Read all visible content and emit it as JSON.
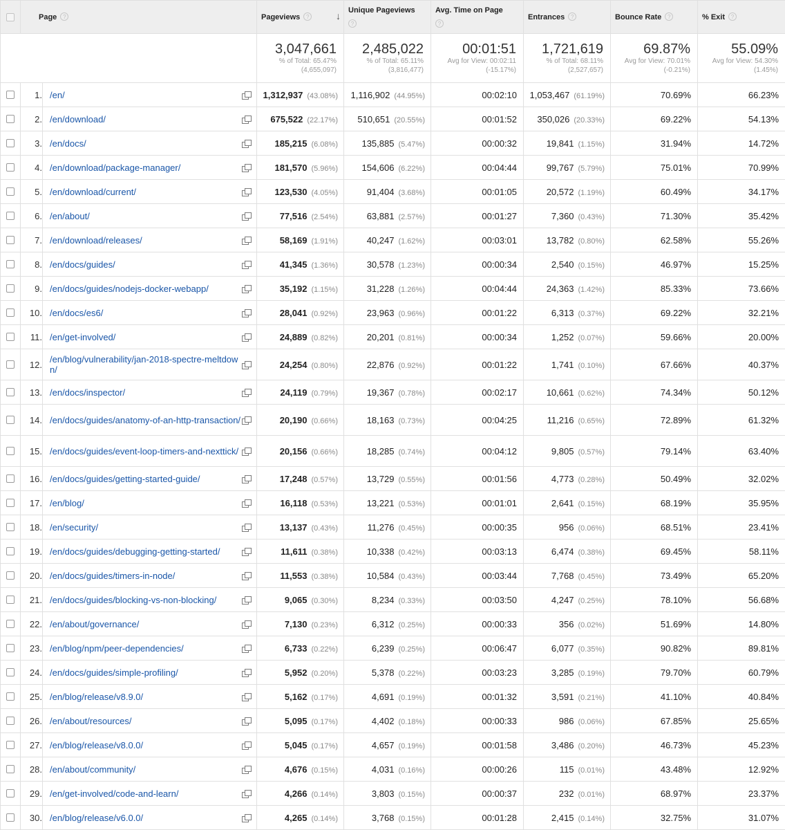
{
  "columns": {
    "page": "Page",
    "pageviews": "Pageviews",
    "unique_pageviews": "Unique Pageviews",
    "avg_time": "Avg. Time on Page",
    "entrances": "Entrances",
    "bounce_rate": "Bounce Rate",
    "exit": "% Exit",
    "help_glyph": "?",
    "sort_glyph": "↓"
  },
  "totals": {
    "pageviews": {
      "value": "3,047,661",
      "line1": "% of Total: 65.47%",
      "line2": "(4,655,097)"
    },
    "unique_pageviews": {
      "value": "2,485,022",
      "line1": "% of Total: 65.11%",
      "line2": "(3,816,477)"
    },
    "avg_time": {
      "value": "00:01:51",
      "line1": "Avg for View: 00:02:11",
      "line2": "(-15.17%)"
    },
    "entrances": {
      "value": "1,721,619",
      "line1": "% of Total: 68.11%",
      "line2": "(2,527,657)"
    },
    "bounce_rate": {
      "value": "69.87%",
      "line1": "Avg for View: 70.01%",
      "line2": "(-0.21%)"
    },
    "exit": {
      "value": "55.09%",
      "line1": "Avg for View: 54.30%",
      "line2": "(1.45%)"
    }
  },
  "rows": [
    {
      "idx": "1.",
      "page": "/en/",
      "pv": "1,312,937",
      "pv_pct": "(43.08%)",
      "upv": "1,116,902",
      "upv_pct": "(44.95%)",
      "time": "00:02:10",
      "ent": "1,053,467",
      "ent_pct": "(61.19%)",
      "bounce": "70.69%",
      "exit": "66.23%"
    },
    {
      "idx": "2.",
      "page": "/en/download/",
      "pv": "675,522",
      "pv_pct": "(22.17%)",
      "upv": "510,651",
      "upv_pct": "(20.55%)",
      "time": "00:01:52",
      "ent": "350,026",
      "ent_pct": "(20.33%)",
      "bounce": "69.22%",
      "exit": "54.13%"
    },
    {
      "idx": "3.",
      "page": "/en/docs/",
      "pv": "185,215",
      "pv_pct": "(6.08%)",
      "upv": "135,885",
      "upv_pct": "(5.47%)",
      "time": "00:00:32",
      "ent": "19,841",
      "ent_pct": "(1.15%)",
      "bounce": "31.94%",
      "exit": "14.72%"
    },
    {
      "idx": "4.",
      "page": "/en/download/package-manager/",
      "pv": "181,570",
      "pv_pct": "(5.96%)",
      "upv": "154,606",
      "upv_pct": "(6.22%)",
      "time": "00:04:44",
      "ent": "99,767",
      "ent_pct": "(5.79%)",
      "bounce": "75.01%",
      "exit": "70.99%"
    },
    {
      "idx": "5.",
      "page": "/en/download/current/",
      "pv": "123,530",
      "pv_pct": "(4.05%)",
      "upv": "91,404",
      "upv_pct": "(3.68%)",
      "time": "00:01:05",
      "ent": "20,572",
      "ent_pct": "(1.19%)",
      "bounce": "60.49%",
      "exit": "34.17%"
    },
    {
      "idx": "6.",
      "page": "/en/about/",
      "pv": "77,516",
      "pv_pct": "(2.54%)",
      "upv": "63,881",
      "upv_pct": "(2.57%)",
      "time": "00:01:27",
      "ent": "7,360",
      "ent_pct": "(0.43%)",
      "bounce": "71.30%",
      "exit": "35.42%"
    },
    {
      "idx": "7.",
      "page": "/en/download/releases/",
      "pv": "58,169",
      "pv_pct": "(1.91%)",
      "upv": "40,247",
      "upv_pct": "(1.62%)",
      "time": "00:03:01",
      "ent": "13,782",
      "ent_pct": "(0.80%)",
      "bounce": "62.58%",
      "exit": "55.26%"
    },
    {
      "idx": "8.",
      "page": "/en/docs/guides/",
      "pv": "41,345",
      "pv_pct": "(1.36%)",
      "upv": "30,578",
      "upv_pct": "(1.23%)",
      "time": "00:00:34",
      "ent": "2,540",
      "ent_pct": "(0.15%)",
      "bounce": "46.97%",
      "exit": "15.25%"
    },
    {
      "idx": "9.",
      "page": "/en/docs/guides/nodejs-docker-webapp/",
      "pv": "35,192",
      "pv_pct": "(1.15%)",
      "upv": "31,228",
      "upv_pct": "(1.26%)",
      "time": "00:04:44",
      "ent": "24,363",
      "ent_pct": "(1.42%)",
      "bounce": "85.33%",
      "exit": "73.66%"
    },
    {
      "idx": "10.",
      "page": "/en/docs/es6/",
      "pv": "28,041",
      "pv_pct": "(0.92%)",
      "upv": "23,963",
      "upv_pct": "(0.96%)",
      "time": "00:01:22",
      "ent": "6,313",
      "ent_pct": "(0.37%)",
      "bounce": "69.22%",
      "exit": "32.21%"
    },
    {
      "idx": "11.",
      "page": "/en/get-involved/",
      "pv": "24,889",
      "pv_pct": "(0.82%)",
      "upv": "20,201",
      "upv_pct": "(0.81%)",
      "time": "00:00:34",
      "ent": "1,252",
      "ent_pct": "(0.07%)",
      "bounce": "59.66%",
      "exit": "20.00%"
    },
    {
      "idx": "12.",
      "page": "/en/blog/vulnerability/jan-2018-spectre-meltdown/",
      "pv": "24,254",
      "pv_pct": "(0.80%)",
      "upv": "22,876",
      "upv_pct": "(0.92%)",
      "time": "00:01:22",
      "ent": "1,741",
      "ent_pct": "(0.10%)",
      "bounce": "67.66%",
      "exit": "40.37%"
    },
    {
      "idx": "13.",
      "page": "/en/docs/inspector/",
      "pv": "24,119",
      "pv_pct": "(0.79%)",
      "upv": "19,367",
      "upv_pct": "(0.78%)",
      "time": "00:02:17",
      "ent": "10,661",
      "ent_pct": "(0.62%)",
      "bounce": "74.34%",
      "exit": "50.12%"
    },
    {
      "idx": "14.",
      "page": "/en/docs/guides/anatomy-of-an-http-transaction/",
      "pv": "20,190",
      "pv_pct": "(0.66%)",
      "upv": "18,163",
      "upv_pct": "(0.73%)",
      "time": "00:04:25",
      "ent": "11,216",
      "ent_pct": "(0.65%)",
      "bounce": "72.89%",
      "exit": "61.32%"
    },
    {
      "idx": "15.",
      "page": "/en/docs/guides/event-loop-timers-and-nexttick/",
      "pv": "20,156",
      "pv_pct": "(0.66%)",
      "upv": "18,285",
      "upv_pct": "(0.74%)",
      "time": "00:04:12",
      "ent": "9,805",
      "ent_pct": "(0.57%)",
      "bounce": "79.14%",
      "exit": "63.40%"
    },
    {
      "idx": "16.",
      "page": "/en/docs/guides/getting-started-guide/",
      "pv": "17,248",
      "pv_pct": "(0.57%)",
      "upv": "13,729",
      "upv_pct": "(0.55%)",
      "time": "00:01:56",
      "ent": "4,773",
      "ent_pct": "(0.28%)",
      "bounce": "50.49%",
      "exit": "32.02%"
    },
    {
      "idx": "17.",
      "page": "/en/blog/",
      "pv": "16,118",
      "pv_pct": "(0.53%)",
      "upv": "13,221",
      "upv_pct": "(0.53%)",
      "time": "00:01:01",
      "ent": "2,641",
      "ent_pct": "(0.15%)",
      "bounce": "68.19%",
      "exit": "35.95%"
    },
    {
      "idx": "18.",
      "page": "/en/security/",
      "pv": "13,137",
      "pv_pct": "(0.43%)",
      "upv": "11,276",
      "upv_pct": "(0.45%)",
      "time": "00:00:35",
      "ent": "956",
      "ent_pct": "(0.06%)",
      "bounce": "68.51%",
      "exit": "23.41%"
    },
    {
      "idx": "19.",
      "page": "/en/docs/guides/debugging-getting-started/",
      "pv": "11,611",
      "pv_pct": "(0.38%)",
      "upv": "10,338",
      "upv_pct": "(0.42%)",
      "time": "00:03:13",
      "ent": "6,474",
      "ent_pct": "(0.38%)",
      "bounce": "69.45%",
      "exit": "58.11%"
    },
    {
      "idx": "20.",
      "page": "/en/docs/guides/timers-in-node/",
      "pv": "11,553",
      "pv_pct": "(0.38%)",
      "upv": "10,584",
      "upv_pct": "(0.43%)",
      "time": "00:03:44",
      "ent": "7,768",
      "ent_pct": "(0.45%)",
      "bounce": "73.49%",
      "exit": "65.20%"
    },
    {
      "idx": "21.",
      "page": "/en/docs/guides/blocking-vs-non-blocking/",
      "pv": "9,065",
      "pv_pct": "(0.30%)",
      "upv": "8,234",
      "upv_pct": "(0.33%)",
      "time": "00:03:50",
      "ent": "4,247",
      "ent_pct": "(0.25%)",
      "bounce": "78.10%",
      "exit": "56.68%"
    },
    {
      "idx": "22.",
      "page": "/en/about/governance/",
      "pv": "7,130",
      "pv_pct": "(0.23%)",
      "upv": "6,312",
      "upv_pct": "(0.25%)",
      "time": "00:00:33",
      "ent": "356",
      "ent_pct": "(0.02%)",
      "bounce": "51.69%",
      "exit": "14.80%"
    },
    {
      "idx": "23.",
      "page": "/en/blog/npm/peer-dependencies/",
      "pv": "6,733",
      "pv_pct": "(0.22%)",
      "upv": "6,239",
      "upv_pct": "(0.25%)",
      "time": "00:06:47",
      "ent": "6,077",
      "ent_pct": "(0.35%)",
      "bounce": "90.82%",
      "exit": "89.81%"
    },
    {
      "idx": "24.",
      "page": "/en/docs/guides/simple-profiling/",
      "pv": "5,952",
      "pv_pct": "(0.20%)",
      "upv": "5,378",
      "upv_pct": "(0.22%)",
      "time": "00:03:23",
      "ent": "3,285",
      "ent_pct": "(0.19%)",
      "bounce": "79.70%",
      "exit": "60.79%"
    },
    {
      "idx": "25.",
      "page": "/en/blog/release/v8.9.0/",
      "pv": "5,162",
      "pv_pct": "(0.17%)",
      "upv": "4,691",
      "upv_pct": "(0.19%)",
      "time": "00:01:32",
      "ent": "3,591",
      "ent_pct": "(0.21%)",
      "bounce": "41.10%",
      "exit": "40.84%"
    },
    {
      "idx": "26.",
      "page": "/en/about/resources/",
      "pv": "5,095",
      "pv_pct": "(0.17%)",
      "upv": "4,402",
      "upv_pct": "(0.18%)",
      "time": "00:00:33",
      "ent": "986",
      "ent_pct": "(0.06%)",
      "bounce": "67.85%",
      "exit": "25.65%"
    },
    {
      "idx": "27.",
      "page": "/en/blog/release/v8.0.0/",
      "pv": "5,045",
      "pv_pct": "(0.17%)",
      "upv": "4,657",
      "upv_pct": "(0.19%)",
      "time": "00:01:58",
      "ent": "3,486",
      "ent_pct": "(0.20%)",
      "bounce": "46.73%",
      "exit": "45.23%"
    },
    {
      "idx": "28.",
      "page": "/en/about/community/",
      "pv": "4,676",
      "pv_pct": "(0.15%)",
      "upv": "4,031",
      "upv_pct": "(0.16%)",
      "time": "00:00:26",
      "ent": "115",
      "ent_pct": "(0.01%)",
      "bounce": "43.48%",
      "exit": "12.92%"
    },
    {
      "idx": "29.",
      "page": "/en/get-involved/code-and-learn/",
      "pv": "4,266",
      "pv_pct": "(0.14%)",
      "upv": "3,803",
      "upv_pct": "(0.15%)",
      "time": "00:00:37",
      "ent": "232",
      "ent_pct": "(0.01%)",
      "bounce": "68.97%",
      "exit": "23.37%"
    },
    {
      "idx": "30.",
      "page": "/en/blog/release/v6.0.0/",
      "pv": "4,265",
      "pv_pct": "(0.14%)",
      "upv": "3,768",
      "upv_pct": "(0.15%)",
      "time": "00:01:28",
      "ent": "2,415",
      "ent_pct": "(0.14%)",
      "bounce": "32.75%",
      "exit": "31.07%"
    }
  ]
}
